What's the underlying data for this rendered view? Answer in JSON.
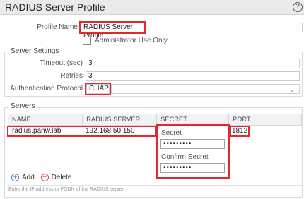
{
  "dialog": {
    "title": "RADIUS Server Profile",
    "help_icon": "?"
  },
  "profile": {
    "name_label": "Profile Name",
    "name_value": "RADIUS Server Profile",
    "admin_only_label": "Administrator Use Only",
    "admin_only_checked": false
  },
  "server_settings": {
    "legend": "Server Settings",
    "timeout_label": "Timeout (sec)",
    "timeout_value": "3",
    "retries_label": "Retries",
    "retries_value": "3",
    "auth_protocol_label": "Authentication Protocol",
    "auth_protocol_value": "CHAP"
  },
  "servers": {
    "legend": "Servers",
    "columns": [
      "NAME",
      "RADIUS SERVER",
      "SECRET",
      "PORT"
    ],
    "rows": [
      {
        "name": "radius.panw.lab",
        "radius_server": "192.168.50.150",
        "secret_label": "Secret",
        "secret_value": "•••••••••",
        "confirm_label": "Confirm Secret",
        "confirm_value": "•••••••••",
        "port": "1812"
      }
    ],
    "add_label": "Add",
    "delete_label": "Delete",
    "hint": "Enter the IP address or FQDN of the RADIUS server"
  },
  "colors": {
    "highlight": "#e3262f",
    "add_icon": "#4a78c0",
    "delete_icon": "#d64545"
  }
}
